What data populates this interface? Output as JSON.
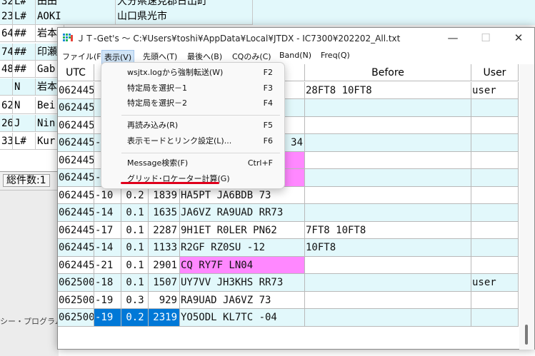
{
  "background_window": {
    "rows": [
      {
        "c1": "32",
        "c2": "L#",
        "c3": "田田",
        "c4": "大分県速見郡日出町"
      },
      {
        "c1": "23",
        "c2": "L#",
        "c3": "AOKI",
        "c4": "山口県光市"
      },
      {
        "c1": "64",
        "c2": "##",
        "c3": "岩本",
        "c4": ""
      },
      {
        "c1": "74",
        "c2": "##",
        "c3": "印瀬",
        "c4": ""
      },
      {
        "c1": "48",
        "c2": "##",
        "c3": "Gab",
        "c4": ""
      },
      {
        "c1": "",
        "c2": "N",
        "c3": "岩本",
        "c4": ""
      },
      {
        "c1": "62",
        "c2": "N",
        "c3": "Bei",
        "c4": ""
      },
      {
        "c1": "26",
        "c2": "J",
        "c3": "Nin",
        "c4": ""
      },
      {
        "c1": "33",
        "c2": "L#",
        "c3": "Kur",
        "c4": ""
      }
    ],
    "status": "総件数:1",
    "program_label": "シー・プログラム"
  },
  "window": {
    "title": "ＪＴ-Get's ～ C:¥Users¥toshi¥AppData¥Local¥JTDX - IC7300¥202202_All.txt",
    "minimize": "—",
    "maximize": "☐",
    "close": "✕"
  },
  "menubar": [
    "ファイル(F)",
    "表示(V)",
    "先頭へ(T)",
    "最後へ(B)",
    "CQのみ(C)",
    "Band(N)",
    "Freq(Q)"
  ],
  "grid": {
    "headers": {
      "utc": "UTC",
      "before": "Before",
      "user": "User"
    },
    "rows": [
      {
        "utc": "062445",
        "db": "",
        "dt": "",
        "freq": "",
        "msg": "",
        "before": "28FT8 10FT8",
        "user": "user"
      },
      {
        "utc": "062445",
        "db": "",
        "dt": "",
        "freq": "",
        "msg": "",
        "before": "",
        "user": ""
      },
      {
        "utc": "062445",
        "db": "",
        "dt": "",
        "freq": "",
        "msg": "",
        "before": "",
        "user": ""
      },
      {
        "utc": "062445",
        "db": "-",
        "dt": "",
        "freq": "",
        "msg": "34",
        "before": "",
        "user": ""
      },
      {
        "utc": "062445",
        "db": "",
        "dt": "",
        "freq": "",
        "msg": "",
        "before": "",
        "user": ""
      },
      {
        "utc": "062445",
        "db": "-",
        "dt": "",
        "freq": "",
        "msg": "",
        "before": "",
        "user": ""
      },
      {
        "utc": "062445",
        "db": "-10",
        "dt": "0.2",
        "freq": "1839",
        "msg": "HA5PT JA6BDB 73",
        "before": "",
        "user": ""
      },
      {
        "utc": "062445",
        "db": "-14",
        "dt": "0.1",
        "freq": "1635",
        "msg": "JA6VZ RA9UAD RR73",
        "before": "",
        "user": ""
      },
      {
        "utc": "062445",
        "db": "-17",
        "dt": "0.1",
        "freq": "2287",
        "msg": "9H1ET R0LER PN62",
        "before": "7FT8 10FT8",
        "user": ""
      },
      {
        "utc": "062445",
        "db": "-14",
        "dt": "0.1",
        "freq": "1133",
        "msg": "R2GF RZ0SU -12",
        "before": "10FT8",
        "user": ""
      },
      {
        "utc": "062445",
        "db": "-21",
        "dt": "0.1",
        "freq": "2901",
        "msg": "CQ RY7F LN04",
        "before": "",
        "user": ""
      },
      {
        "utc": "062500",
        "db": "-18",
        "dt": "0.1",
        "freq": "1507",
        "msg": "UY7VV JH3KHS RR73",
        "before": "",
        "user": "user"
      },
      {
        "utc": "062500",
        "db": "-19",
        "dt": "0.3",
        "freq": "929",
        "msg": "RA9UAD JA6VZ 73",
        "before": "",
        "user": ""
      },
      {
        "utc": "062500",
        "db": "-19",
        "dt": "0.2",
        "freq": "2319",
        "msg": "YO5ODL KL7TC -04",
        "before": "",
        "user": ""
      }
    ]
  },
  "dropdown": {
    "items": [
      {
        "label": "wsjtx.logから強制転送(W)",
        "key": "F2"
      },
      {
        "label": "特定局を選択－1",
        "key": "F3"
      },
      {
        "label": "特定局を選択－2",
        "key": "F4"
      },
      {
        "label": "再読み込み(R)",
        "key": "F5"
      },
      {
        "label": "表示モードとリンク設定(L)...",
        "key": "F6"
      },
      {
        "label": "Message検索(F)",
        "key": "Ctrl+F"
      },
      {
        "label": "グリッド･ロケーター計算(G)",
        "key": ""
      }
    ]
  },
  "colors": {
    "row_alt": "#e2f8fb",
    "cq_highlight": "#ff88ff",
    "selection": "#0078d7",
    "annotation_underline": "#e0001b"
  }
}
